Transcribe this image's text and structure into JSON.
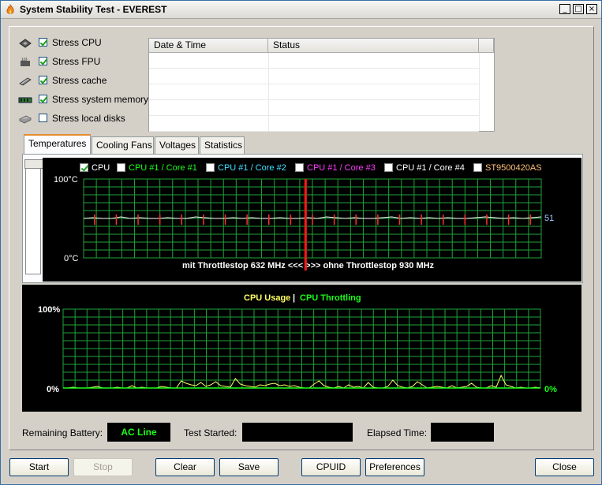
{
  "window": {
    "title": "System Stability Test - EVEREST",
    "minimize": "_",
    "maximize": "□",
    "close": "×"
  },
  "stress_options": [
    {
      "label": "Stress CPU",
      "checked": true,
      "icon": "cpu-chip-icon"
    },
    {
      "label": "Stress FPU",
      "checked": true,
      "icon": "fpu-icon"
    },
    {
      "label": "Stress cache",
      "checked": true,
      "icon": "cache-icon"
    },
    {
      "label": "Stress system memory",
      "checked": true,
      "icon": "memory-icon"
    },
    {
      "label": "Stress local disks",
      "checked": false,
      "icon": "disk-icon"
    }
  ],
  "log_table": {
    "columns": [
      "Date & Time",
      "Status"
    ],
    "rows": []
  },
  "tabs": [
    {
      "label": "Temperatures",
      "active": true
    },
    {
      "label": "Cooling Fans",
      "active": false
    },
    {
      "label": "Voltages",
      "active": false
    },
    {
      "label": "Statistics",
      "active": false
    }
  ],
  "temperature_chart": {
    "sensors": [
      {
        "label": "CPU",
        "checked": true,
        "color": "#ffffff"
      },
      {
        "label": "CPU #1 / Core #1",
        "checked": false,
        "color": "#1bff1b"
      },
      {
        "label": "CPU #1 / Core #2",
        "checked": false,
        "color": "#3fe0ff"
      },
      {
        "label": "CPU #1 / Core #3",
        "checked": false,
        "color": "#ff3cff"
      },
      {
        "label": "CPU #1 / Core #4",
        "checked": false,
        "color": "#ffffff"
      },
      {
        "label": "ST9500420AS",
        "checked": false,
        "color": "#ffc07a"
      }
    ],
    "y_max_label": "100°C",
    "y_min_label": "0°C",
    "current_value": "51",
    "annotation": "mit Throttlestop 632 MHz <<<  >>> ohne Throttlestop 930 MHz",
    "grid_color": "#1fa33a"
  },
  "chart_data": [
    {
      "type": "line",
      "title": "",
      "series": [
        {
          "name": "CPU",
          "values": [
            50,
            51,
            50,
            50,
            52,
            50,
            51,
            50,
            50,
            51,
            50,
            50,
            52,
            51,
            50,
            50,
            51,
            50,
            51,
            50,
            50,
            51,
            50,
            50,
            51,
            50,
            52,
            51,
            50,
            51,
            50,
            50,
            51,
            52,
            50,
            51,
            50,
            51,
            50,
            51,
            50,
            50,
            51,
            52,
            51,
            50,
            51,
            50,
            51,
            52
          ]
        }
      ],
      "ylim": [
        0,
        100
      ],
      "y_tick_labels": [
        "100°C",
        "0°C"
      ]
    },
    {
      "type": "line",
      "legend": [
        "CPU Usage",
        "CPU Throttling"
      ],
      "series": [
        {
          "name": "CPU Usage",
          "color": "#ffff66",
          "values": [
            0,
            0,
            1,
            0,
            0,
            0,
            1,
            2,
            0,
            0,
            0,
            1,
            0,
            0,
            3,
            0,
            1,
            0,
            0,
            0,
            2,
            1,
            0,
            0,
            9,
            6,
            4,
            3,
            7,
            2,
            4,
            8,
            3,
            2,
            1,
            12,
            5,
            3,
            2,
            1,
            4,
            3,
            5,
            6,
            3,
            4,
            2,
            3,
            1,
            0,
            0,
            5,
            9,
            3,
            1,
            0,
            2,
            0,
            4,
            1,
            2,
            0,
            7,
            1,
            0,
            0,
            2,
            10,
            3,
            1,
            0,
            2,
            8,
            4,
            0,
            1,
            2,
            1,
            0,
            3,
            0,
            1,
            2,
            6,
            1,
            0,
            0,
            3,
            1,
            16,
            4,
            2,
            0,
            1,
            0,
            0,
            1,
            0
          ]
        },
        {
          "name": "CPU Throttling",
          "color": "#1bff1b",
          "values": [
            0,
            0,
            0,
            0,
            0,
            0,
            0,
            0,
            0,
            0,
            0,
            0,
            0,
            0,
            0,
            0,
            0,
            0,
            0,
            0,
            0,
            0,
            0,
            0,
            0,
            0,
            0,
            0,
            0,
            0,
            0,
            0,
            0,
            0,
            0,
            0,
            0,
            0,
            0,
            0,
            0,
            0,
            0,
            0,
            0,
            0,
            0,
            0,
            0,
            0,
            0,
            0,
            0,
            0,
            0,
            0,
            0,
            0,
            0,
            0,
            0,
            0,
            0,
            0,
            0,
            0,
            0,
            0,
            0,
            0,
            0,
            0,
            0,
            0,
            0,
            0,
            0,
            0,
            0,
            0,
            0,
            0,
            0,
            0,
            0,
            0,
            0,
            0,
            0,
            0,
            0,
            0,
            0,
            0,
            0,
            0,
            0,
            0
          ]
        }
      ],
      "ylim": [
        0,
        100
      ],
      "y_tick_labels": [
        "100%",
        "0%"
      ],
      "current_value": "0%"
    }
  ],
  "status": {
    "battery_label": "Remaining Battery:",
    "battery_value": "AC Line",
    "started_label": "Test Started:",
    "started_value": "",
    "elapsed_label": "Elapsed Time:",
    "elapsed_value": ""
  },
  "buttons": {
    "start": "Start",
    "stop": "Stop",
    "clear": "Clear",
    "save": "Save",
    "cpuid": "CPUID",
    "preferences": "Preferences",
    "close": "Close"
  }
}
